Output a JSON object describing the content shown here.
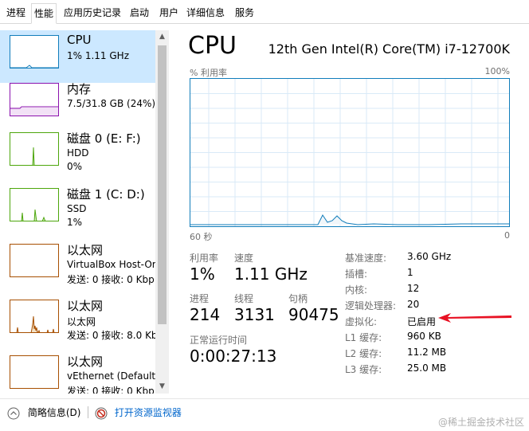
{
  "tabs": [
    "进程",
    "性能",
    "应用历史记录",
    "启动",
    "用户",
    "详细信息",
    "服务"
  ],
  "sidebar": {
    "items": [
      {
        "title": "CPU",
        "sub1": "1% 1.11 GHz",
        "sub2": ""
      },
      {
        "title": "内存",
        "sub1": "7.5/31.8 GB (24%)",
        "sub2": ""
      },
      {
        "title": "磁盘 0 (E: F:)",
        "sub1": "HDD",
        "sub2": "0%"
      },
      {
        "title": "磁盘 1 (C: D:)",
        "sub1": "SSD",
        "sub2": "1%"
      },
      {
        "title": "以太网",
        "sub1": "VirtualBox Host-Or",
        "sub2": "发送: 0 接收: 0 Kbp"
      },
      {
        "title": "以太网",
        "sub1": "以太网",
        "sub2": "发送: 0 接收: 8.0 Kb"
      },
      {
        "title": "以太网",
        "sub1": "vEthernet (Default ,",
        "sub2": "发送: 0 接收: 0 Kbp"
      }
    ]
  },
  "main": {
    "title": "CPU",
    "model": "12th Gen Intel(R) Core(TM) i7-12700K",
    "chart_ylabel": "% 利用率",
    "chart_ymax": "100%",
    "chart_xleft": "60 秒",
    "chart_xright": "0",
    "stats": {
      "util_label": "利用率",
      "util_value": "1%",
      "speed_label": "速度",
      "speed_value": "1.11 GHz",
      "proc_label": "进程",
      "proc_value": "214",
      "threads_label": "线程",
      "threads_value": "3131",
      "handles_label": "句柄",
      "handles_value": "90475",
      "uptime_label": "正常运行时间",
      "uptime_value": "0:00:27:13"
    },
    "specs": [
      {
        "label": "基准速度:",
        "value": "3.60 GHz"
      },
      {
        "label": "插槽:",
        "value": "1"
      },
      {
        "label": "内核:",
        "value": "12"
      },
      {
        "label": "逻辑处理器:",
        "value": "20"
      },
      {
        "label": "虚拟化:",
        "value": "已启用"
      },
      {
        "label": "L1 缓存:",
        "value": "960 KB"
      },
      {
        "label": "L2 缓存:",
        "value": "11.2 MB"
      },
      {
        "label": "L3 缓存:",
        "value": "25.0 MB"
      }
    ]
  },
  "footer": {
    "brief_label": "简略信息(D)",
    "monitor_label": "打开资源监视器",
    "watermark": "@稀土掘金技术社区"
  },
  "colors": {
    "cpu": "#117dbb",
    "memory": "#8b12ae",
    "disk": "#4da60c",
    "ethernet": "#a74f01",
    "arrow": "#e81123",
    "link": "#0066cc"
  },
  "icons": {
    "brief": "chevron-up-circle-icon",
    "monitor": "resource-monitor-icon"
  }
}
